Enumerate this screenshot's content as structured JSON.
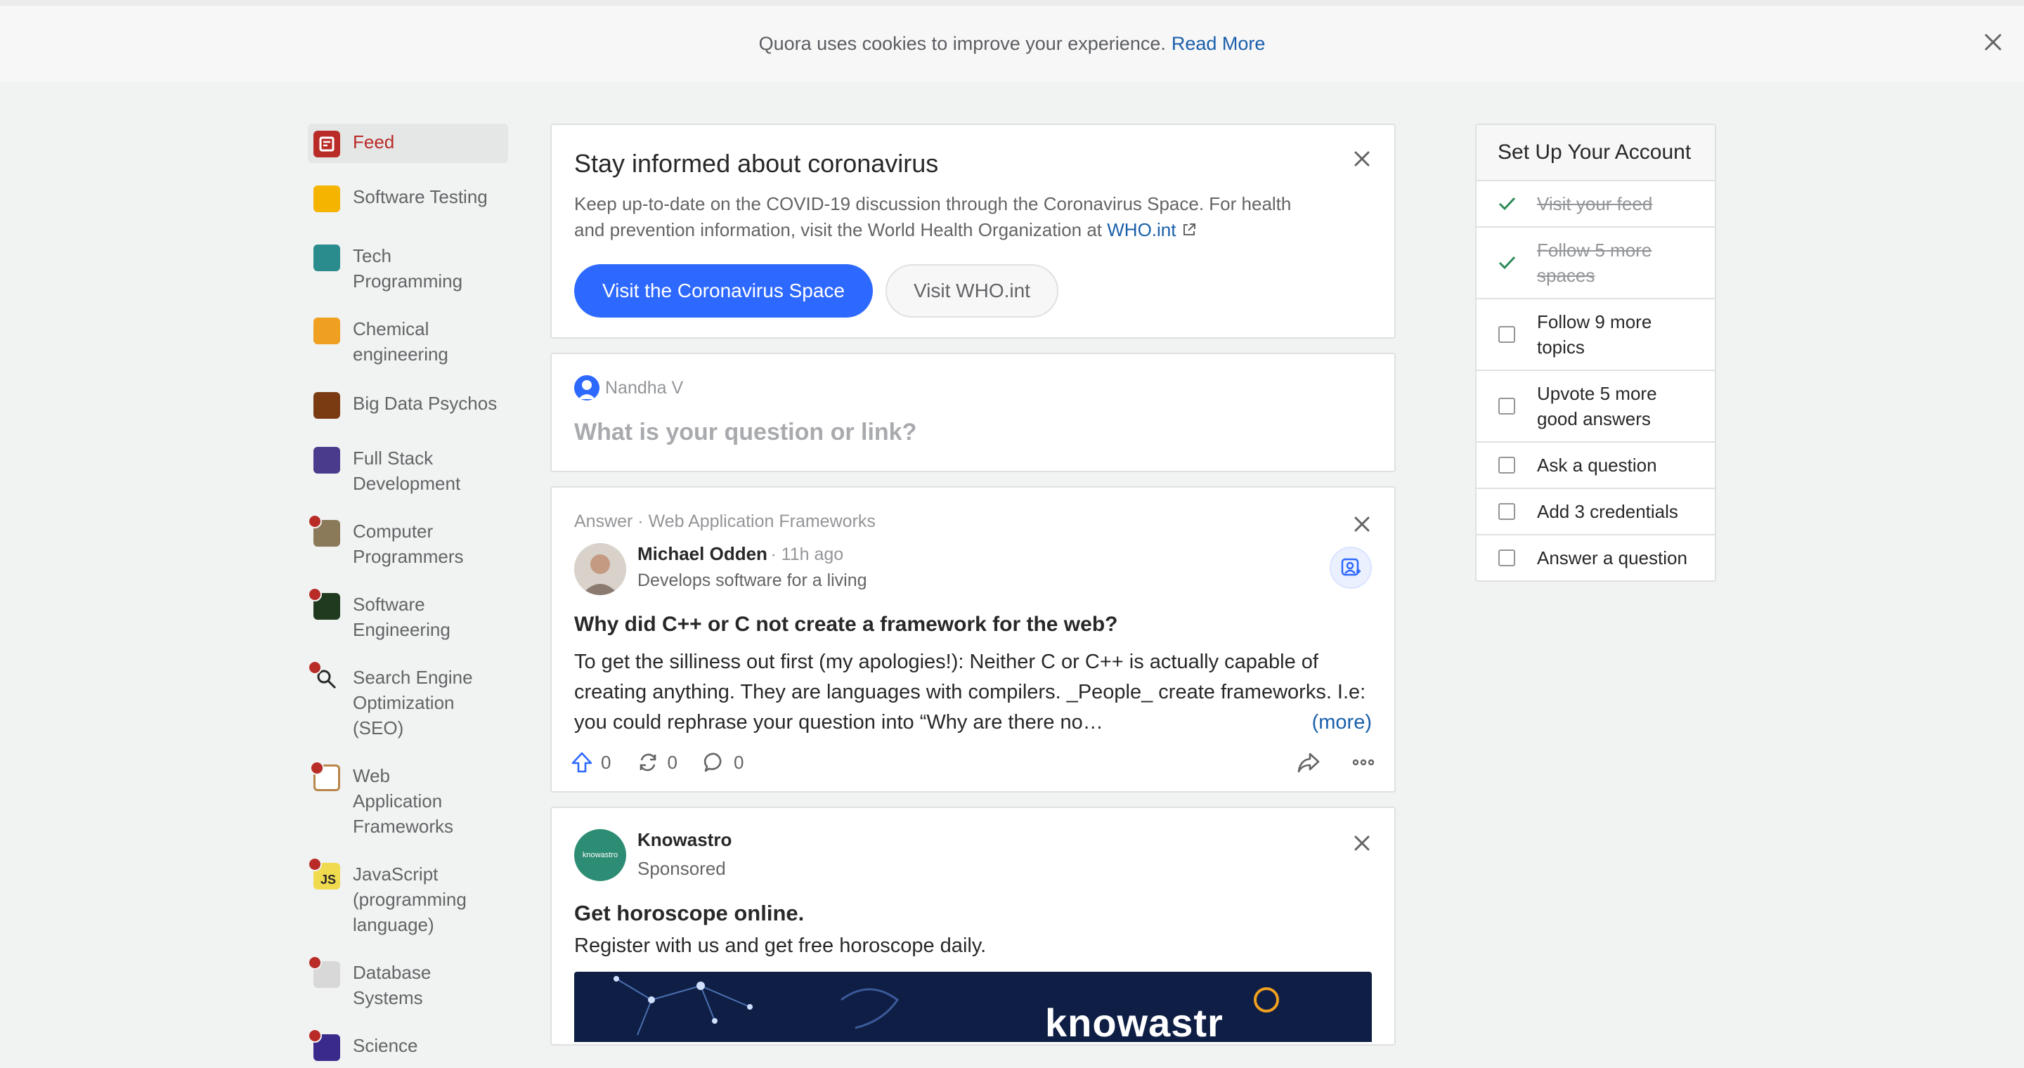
{
  "cookie": {
    "text": "Quora uses cookies to improve your experience.",
    "link": "Read More"
  },
  "sidebar": {
    "items": [
      {
        "label": "Feed",
        "color": "#b92b27",
        "dot": false
      },
      {
        "label": "Software Testing",
        "color": "#f4b400",
        "dot": false
      },
      {
        "label": "Tech Programming",
        "color": "#2a8c8c",
        "dot": false
      },
      {
        "label": "Chemical engineering",
        "color": "#f0a020",
        "dot": false
      },
      {
        "label": "Big Data Psychos",
        "color": "#7a3b12",
        "dot": false
      },
      {
        "label": "Full Stack Development",
        "color": "#4a3b8c",
        "dot": false
      },
      {
        "label": "Computer Programmers",
        "color": "#8a7a5a",
        "dot": true
      },
      {
        "label": "Software Engineering",
        "color": "#1f3a1f",
        "dot": true
      },
      {
        "label": "Search Engine Optimization (SEO)",
        "color": "#e8e8e8",
        "dot": true
      },
      {
        "label": "Web Application Frameworks",
        "color": "#f2e8d8",
        "dot": true
      },
      {
        "label": "JavaScript (programming language)",
        "color": "#f0db4f",
        "dot": true
      },
      {
        "label": "Database Systems",
        "color": "#d8d8d8",
        "dot": true
      },
      {
        "label": "Science",
        "color": "#3a2a8c",
        "dot": true
      }
    ]
  },
  "covid": {
    "title": "Stay informed about coronavirus",
    "body": "Keep up-to-date on the COVID-19 discussion through the Coronavirus Space. For health and prevention information, visit the World Health Organization at",
    "link": "WHO.int",
    "primary_button": "Visit the Coronavirus Space",
    "secondary_button": "Visit WHO.int"
  },
  "ask": {
    "user": "Nandha V",
    "placeholder": "What is your question or link?"
  },
  "answer": {
    "meta": "Answer · Web Application Frameworks",
    "author": "Michael Odden",
    "time": "· 11h ago",
    "credential": "Develops software for a living",
    "question": "Why did C++ or C not create a framework for the web?",
    "excerpt": "To get the silliness out first (my apologies!): Neither C or C++ is actually capable of creating anything. They are languages with compilers. _People_ create frameworks. I.e: you could rephrase your question into “Why are there no…",
    "more": "(more)",
    "upvotes": "0",
    "shares": "0",
    "comments": "0"
  },
  "ad": {
    "brand": "Knowastro",
    "sponsored": "Sponsored",
    "logo_text": "knowastro",
    "headline": "Get horoscope online.",
    "text": "Register with us and get free horoscope daily.",
    "banner_text": "knowastr"
  },
  "setup": {
    "title": "Set Up Your Account",
    "items": [
      {
        "label": "Visit your feed",
        "done": true
      },
      {
        "label": "Follow 5 more spaces",
        "done": true
      },
      {
        "label": "Follow 9 more topics",
        "done": false
      },
      {
        "label": "Upvote 5 more good answers",
        "done": false
      },
      {
        "label": "Ask a question",
        "done": false
      },
      {
        "label": "Add 3 credentials",
        "done": false
      },
      {
        "label": "Answer a question",
        "done": false
      }
    ]
  },
  "colors": {
    "accent": "#b92b27",
    "primary_blue": "#2e69ff",
    "link_blue": "#195faa",
    "check_green": "#2e8b57"
  }
}
